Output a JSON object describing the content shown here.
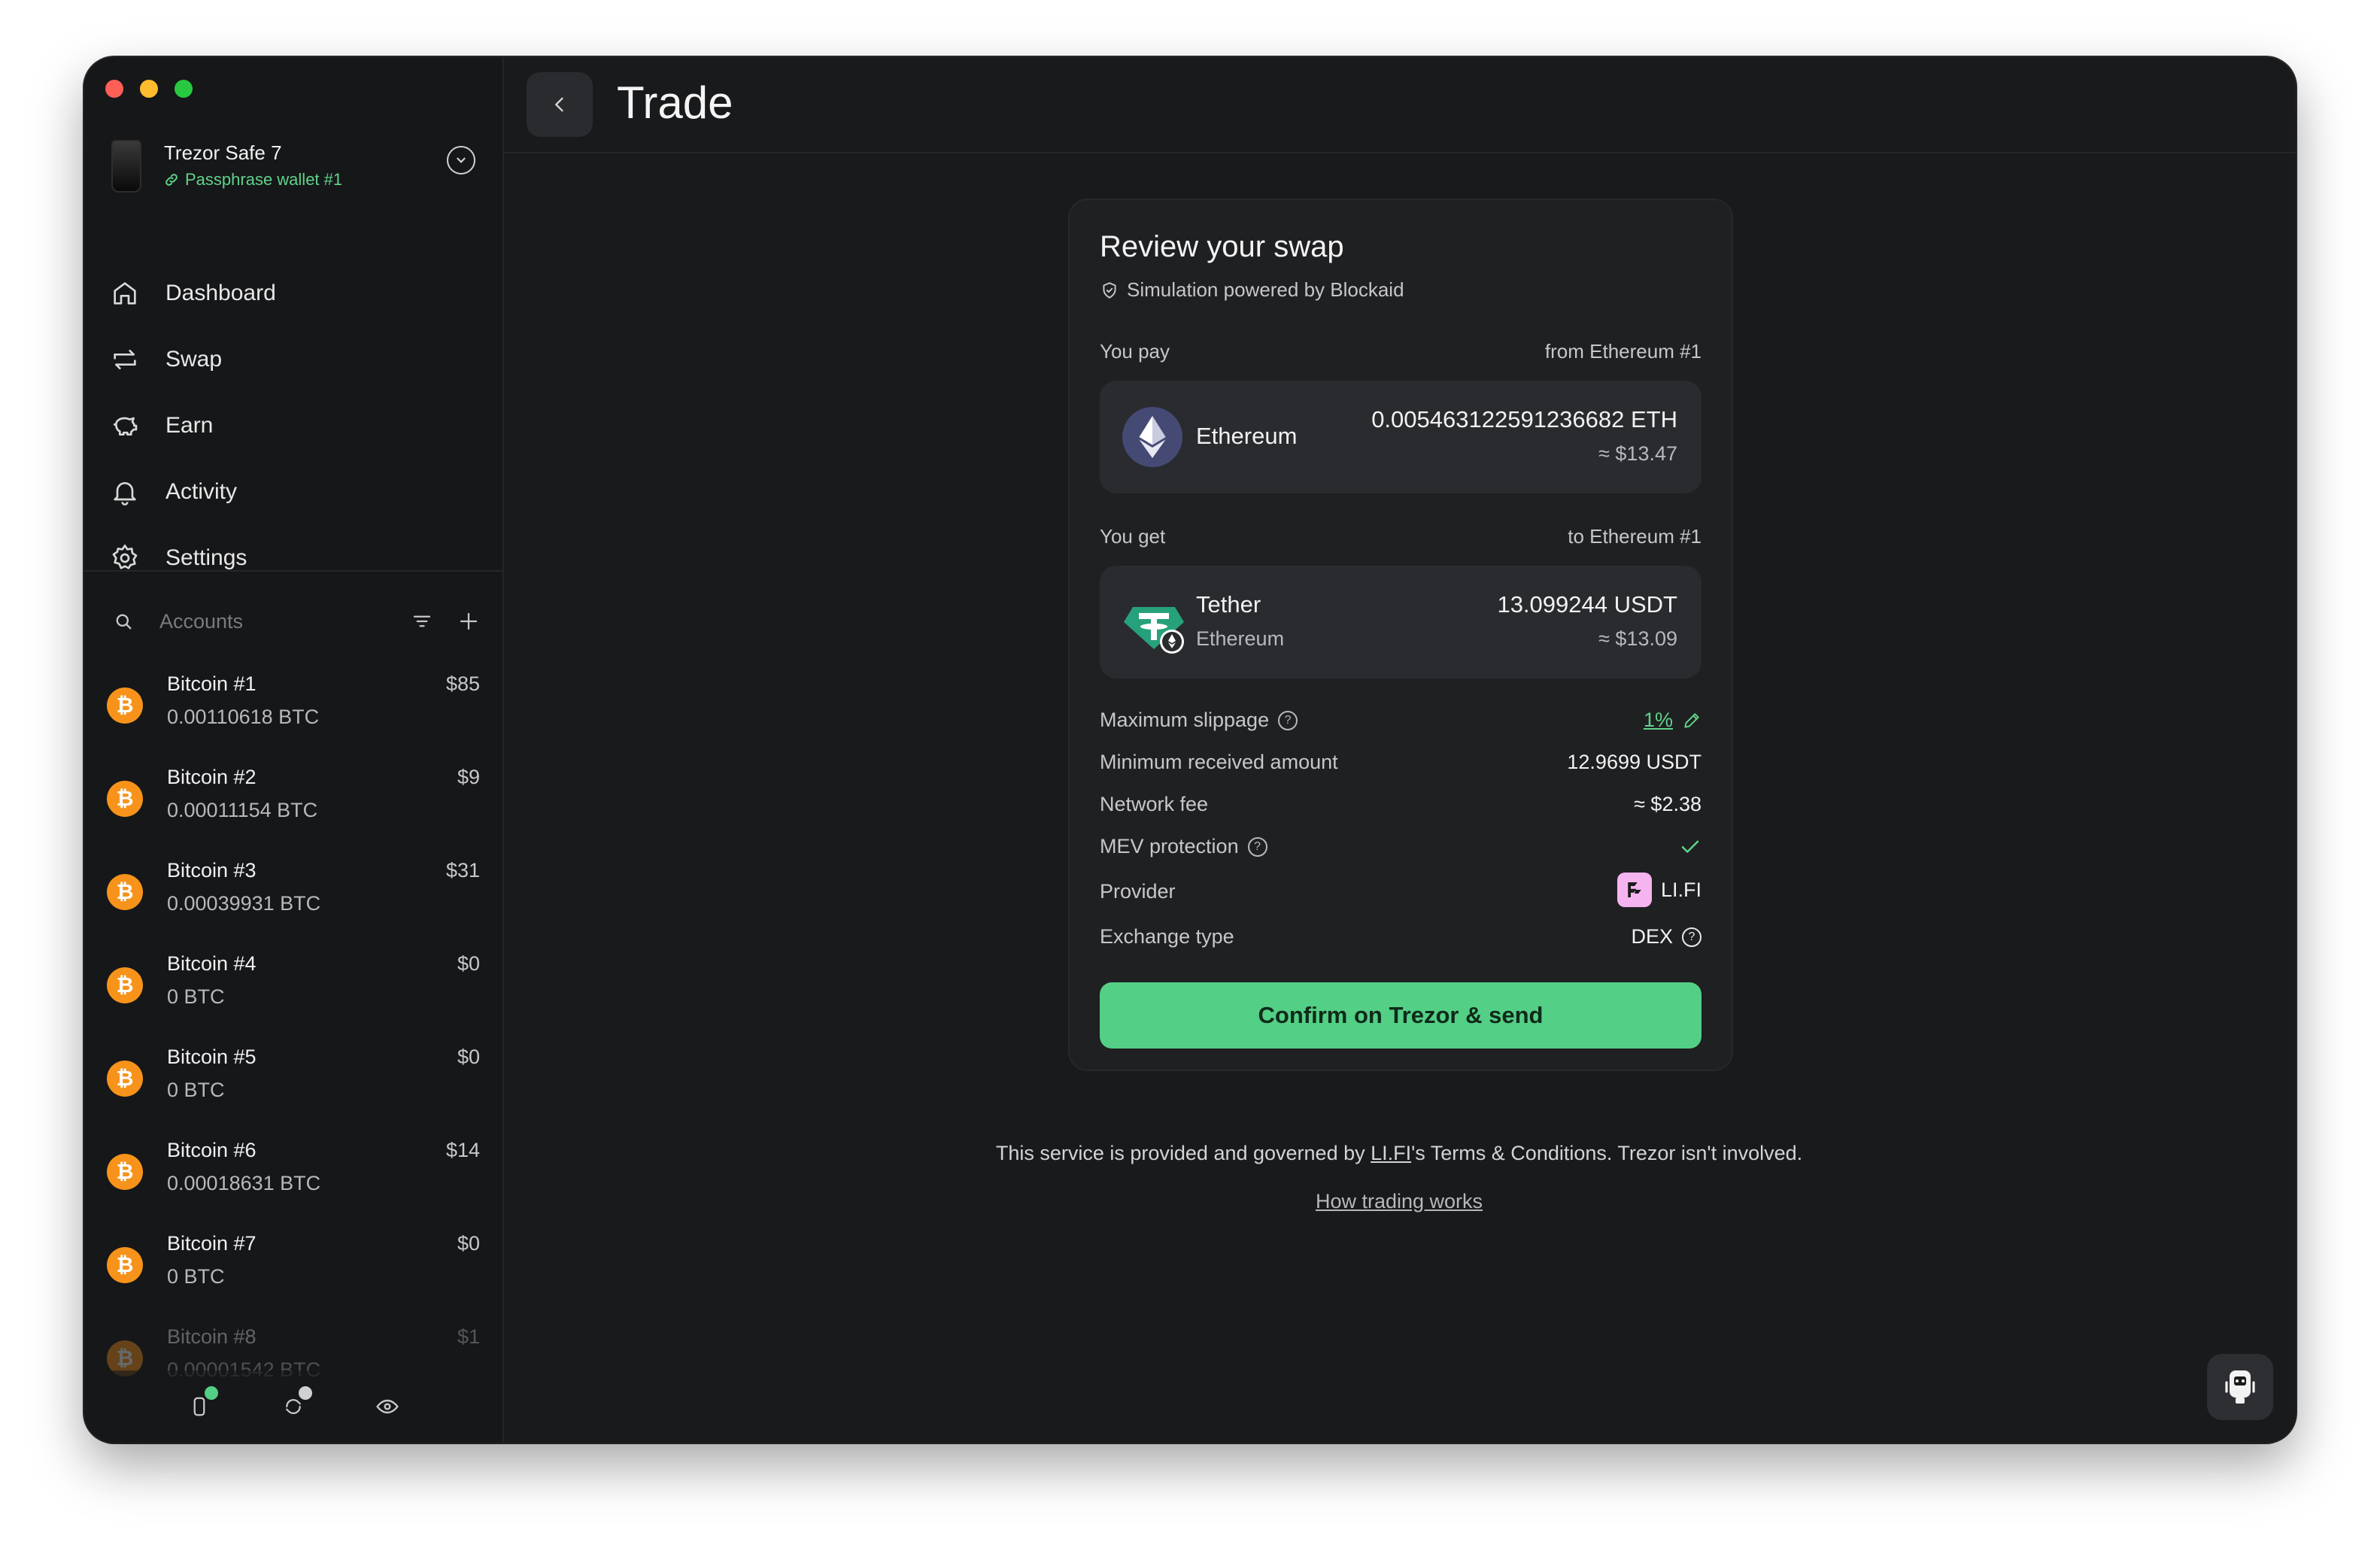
{
  "device": {
    "name": "Trezor Safe 7",
    "wallet": "Passphrase wallet #1"
  },
  "nav": {
    "dashboard": "Dashboard",
    "swap": "Swap",
    "earn": "Earn",
    "activity": "Activity",
    "settings": "Settings"
  },
  "accounts_header": {
    "label": "Accounts"
  },
  "accounts": [
    {
      "name": "Bitcoin #1",
      "balance": "0.00110618 BTC",
      "fiat": "$85"
    },
    {
      "name": "Bitcoin #2",
      "balance": "0.00011154 BTC",
      "fiat": "$9"
    },
    {
      "name": "Bitcoin #3",
      "balance": "0.00039931 BTC",
      "fiat": "$31"
    },
    {
      "name": "Bitcoin #4",
      "balance": "0 BTC",
      "fiat": "$0"
    },
    {
      "name": "Bitcoin #5",
      "balance": "0 BTC",
      "fiat": "$0"
    },
    {
      "name": "Bitcoin #6",
      "balance": "0.00018631 BTC",
      "fiat": "$14"
    },
    {
      "name": "Bitcoin #7",
      "balance": "0 BTC",
      "fiat": "$0"
    },
    {
      "name": "Bitcoin #8",
      "balance": "0.00001542 BTC",
      "fiat": "$1"
    }
  ],
  "header": {
    "title": "Trade"
  },
  "review": {
    "title": "Review your swap",
    "simulation": "Simulation powered by Blockaid",
    "pay": {
      "label": "You pay",
      "from": "from Ethereum #1",
      "asset": "Ethereum",
      "amount": "0.005463122591236682 ETH",
      "fiat": "≈ $13.47"
    },
    "get": {
      "label": "You get",
      "to": "to Ethereum #1",
      "asset": "Tether",
      "network": "Ethereum",
      "amount": "13.099244 USDT",
      "fiat": "≈ $13.09"
    },
    "details": {
      "slippage_label": "Maximum slippage",
      "slippage_value": "1%",
      "min_received_label": "Minimum received amount",
      "min_received_value": "12.9699 USDT",
      "network_fee_label": "Network fee",
      "network_fee_value": "≈ $2.38",
      "mev_label": "MEV protection",
      "provider_label": "Provider",
      "provider_value": "LI.FI",
      "exchange_type_label": "Exchange type",
      "exchange_type_value": "DEX"
    },
    "confirm_label": "Confirm on Trezor & send"
  },
  "footer": {
    "prefix": "This service is provided and governed by ",
    "provider": "LI.FI",
    "suffix": "'s Terms & Conditions. Trezor isn't involved.",
    "link": "How trading works"
  },
  "colors": {
    "accent": "#54cf86",
    "bitcoin": "#f7931a",
    "tether": "#26a17b",
    "ethereum_bg": "#454a75"
  }
}
